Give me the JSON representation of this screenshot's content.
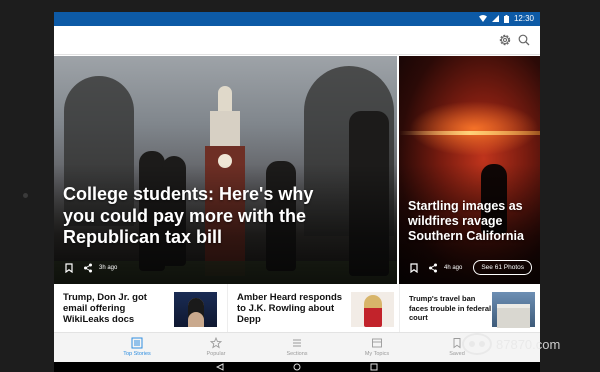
{
  "status_bar": {
    "time": "12:30"
  },
  "app_bar": {
    "icons": [
      "settings-gear-icon",
      "search-icon"
    ]
  },
  "hero_main": {
    "headline": "College students: Here's why you could pay more with the Republican tax bill",
    "age": "3h ago"
  },
  "hero_side": {
    "headline": "Startling images as wildfires ravage Southern California",
    "age": "4h ago",
    "photos_button": "See 61 Photos"
  },
  "cards": [
    {
      "title": "Trump, Don Jr. got email offering WikiLeaks docs"
    },
    {
      "title": "Amber Heard responds to J.K. Rowling about Depp"
    },
    {
      "title": "Trump's travel ban faces trouble in federal court"
    }
  ],
  "bottom_nav": [
    {
      "label": "Top Stories",
      "icon": "stories-icon",
      "active": true
    },
    {
      "label": "Popular",
      "icon": "star-icon",
      "active": false
    },
    {
      "label": "Sections",
      "icon": "list-icon",
      "active": false
    },
    {
      "label": "My Topics",
      "icon": "topics-icon",
      "active": false
    },
    {
      "label": "Saved",
      "icon": "bookmark-icon",
      "active": false
    }
  ],
  "watermark": {
    "text": "87870.com"
  },
  "colors": {
    "status_bar": "#0d5aa6",
    "accent": "#2f8ee0"
  }
}
